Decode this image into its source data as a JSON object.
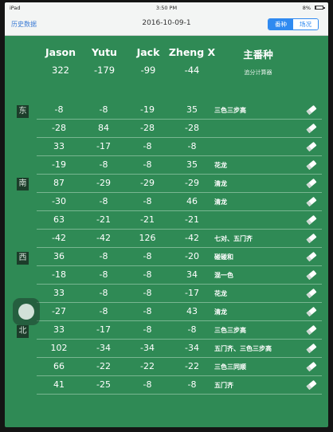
{
  "status_bar": {
    "carrier": "iPad",
    "time": "3:50 PM",
    "battery": "8%",
    "battery_level": 0.08
  },
  "nav": {
    "back_label": "历史数据",
    "title": "2016-10-09-1",
    "segments": [
      {
        "label": "番种",
        "active": true
      },
      {
        "label": "场况",
        "active": false
      }
    ]
  },
  "players": [
    {
      "name": "Jason",
      "total": "322"
    },
    {
      "name": "Yutu",
      "total": "-179"
    },
    {
      "name": "Jack",
      "total": "-99"
    },
    {
      "name": "Zheng X",
      "total": "-44"
    }
  ],
  "main_header": {
    "title": "主番种",
    "subtitle": "追分计算器"
  },
  "winds": [
    "东",
    "南",
    "西",
    "北"
  ],
  "rows": [
    {
      "scores": [
        "-8",
        "-8",
        "-19",
        "35"
      ],
      "hand": "三色三步高"
    },
    {
      "scores": [
        "-28",
        "84",
        "-28",
        "-28"
      ],
      "hand": ""
    },
    {
      "scores": [
        "33",
        "-17",
        "-8",
        "-8"
      ],
      "hand": ""
    },
    {
      "scores": [
        "-19",
        "-8",
        "-8",
        "35"
      ],
      "hand": "花龙"
    },
    {
      "scores": [
        "87",
        "-29",
        "-29",
        "-29"
      ],
      "hand": "清龙"
    },
    {
      "scores": [
        "-30",
        "-8",
        "-8",
        "46"
      ],
      "hand": "清龙"
    },
    {
      "scores": [
        "63",
        "-21",
        "-21",
        "-21"
      ],
      "hand": ""
    },
    {
      "scores": [
        "-42",
        "-42",
        "126",
        "-42"
      ],
      "hand": "七对、五门齐"
    },
    {
      "scores": [
        "36",
        "-8",
        "-8",
        "-20"
      ],
      "hand": "碰碰和"
    },
    {
      "scores": [
        "-18",
        "-8",
        "-8",
        "34"
      ],
      "hand": "混一色"
    },
    {
      "scores": [
        "33",
        "-8",
        "-8",
        "-17"
      ],
      "hand": "花龙"
    },
    {
      "scores": [
        "-27",
        "-8",
        "-8",
        "43"
      ],
      "hand": "清龙"
    },
    {
      "scores": [
        "33",
        "-17",
        "-8",
        "-8"
      ],
      "hand": "三色三步高"
    },
    {
      "scores": [
        "102",
        "-34",
        "-34",
        "-34"
      ],
      "hand": "五门齐、三色三步高"
    },
    {
      "scores": [
        "66",
        "-22",
        "-22",
        "-22"
      ],
      "hand": "三色三同顺"
    },
    {
      "scores": [
        "41",
        "-25",
        "-8",
        "-8"
      ],
      "hand": "五门齐"
    }
  ]
}
